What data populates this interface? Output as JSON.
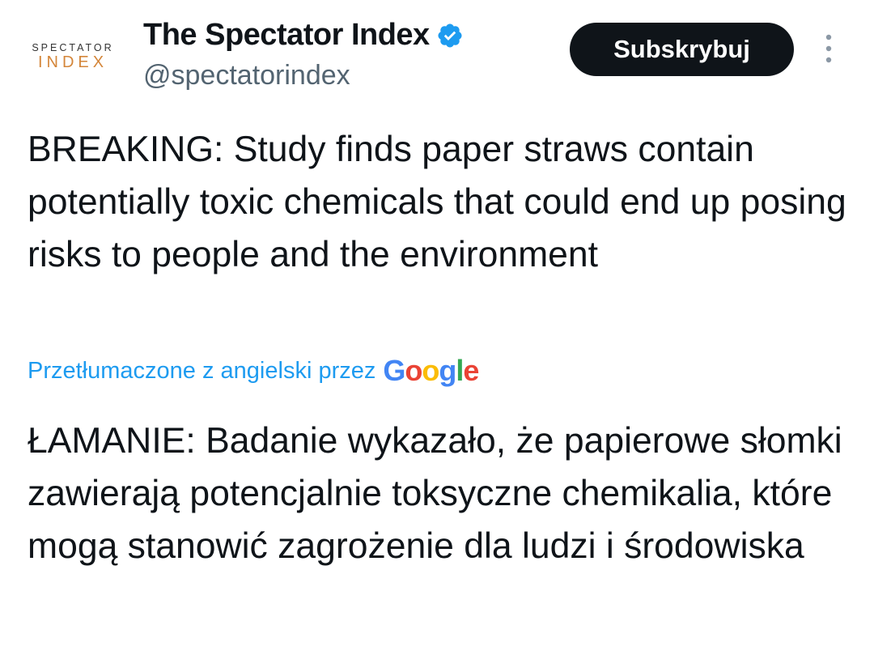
{
  "author": {
    "avatar_logo_top": "SPECTATOR",
    "avatar_logo_bottom": "INDEX",
    "display_name": "The Spectator Index",
    "handle": "@spectatorindex",
    "verified_icon": "verified-badge-icon"
  },
  "actions": {
    "subscribe_label": "Subskrybuj",
    "more_icon": "more-vertical-icon"
  },
  "tweet": {
    "text": "BREAKING: Study finds paper straws contain potentially toxic chemicals that could end up posing risks to people and the environment",
    "translated_label": "Przetłumaczone z angielski przez",
    "translation_provider": {
      "letters": [
        "G",
        "o",
        "o",
        "g",
        "l",
        "e"
      ]
    },
    "translated_text": "ŁAMANIE: Badanie wykazało, że papierowe słomki zawierają potencjalnie toksyczne chemikalia, które mogą stanowić zagrożenie dla ludzi i środowiska"
  },
  "colors": {
    "accent_blue": "#1d9bf0",
    "text_primary": "#0f1419",
    "text_secondary": "#536471",
    "logo_orange": "#d4863a"
  }
}
